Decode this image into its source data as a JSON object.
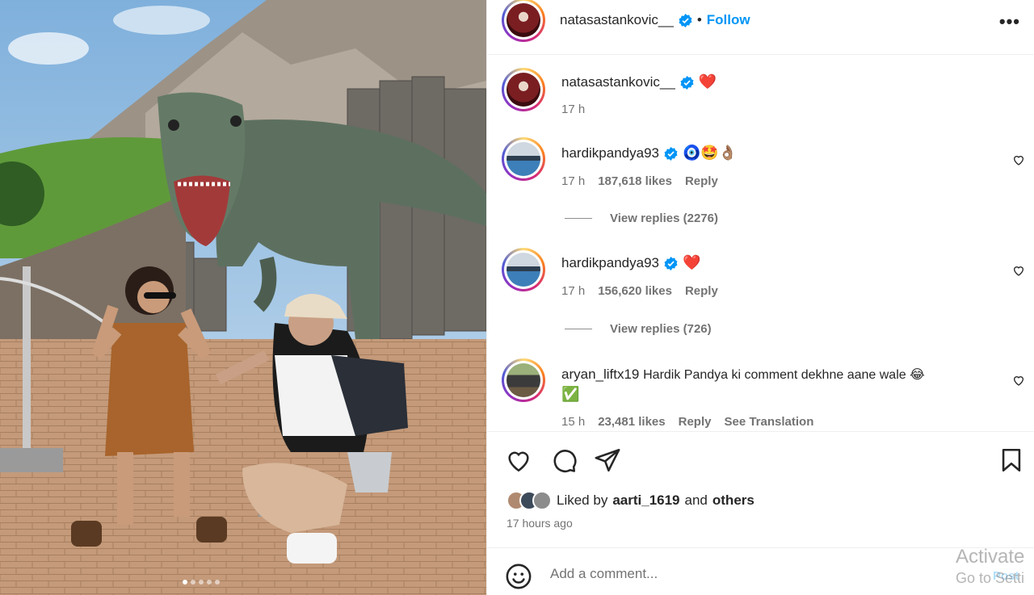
{
  "header": {
    "username": "natasastankovic__",
    "separator": "•",
    "follow_label": "Follow",
    "more_label": "•••"
  },
  "caption": {
    "username": "natasastankovic__",
    "text": "❤️",
    "time": "17 h"
  },
  "comments": [
    {
      "username": "hardikpandya93",
      "text": "🧿🤩👌🏽",
      "time": "17 h",
      "likes": "187,618 likes",
      "reply_label": "Reply",
      "view_replies": "View replies (2276)"
    },
    {
      "username": "hardikpandya93",
      "text": "❤️",
      "time": "17 h",
      "likes": "156,620 likes",
      "reply_label": "Reply",
      "view_replies": "View replies (726)"
    },
    {
      "username": "aryan_liftx19",
      "text": "Hardik Pandya ki comment dekhne aane wale 😂",
      "text_line2": "✅",
      "time": "15 h",
      "likes": "23,481 likes",
      "reply_label": "Reply",
      "translate_label": "See Translation"
    }
  ],
  "icons": {
    "like": "heart-icon",
    "comment": "comment-icon",
    "share": "share-icon",
    "save": "bookmark-icon",
    "emoji": "smiley-icon",
    "verified": "verified-badge-icon"
  },
  "likes_summary": {
    "prefix": "Liked by",
    "user": "aarti_1619",
    "conjunction": "and",
    "others": "others"
  },
  "post_time": "17 hours ago",
  "add_comment": {
    "placeholder": "Add a comment...",
    "post_label": "Post"
  },
  "watermark": {
    "line1": "Activate",
    "line2": "Go to Setti"
  },
  "colors": {
    "accent": "#0095f6",
    "verified": "#0095f6",
    "heart_red": "#ed1c3a",
    "muted": "#737373"
  }
}
